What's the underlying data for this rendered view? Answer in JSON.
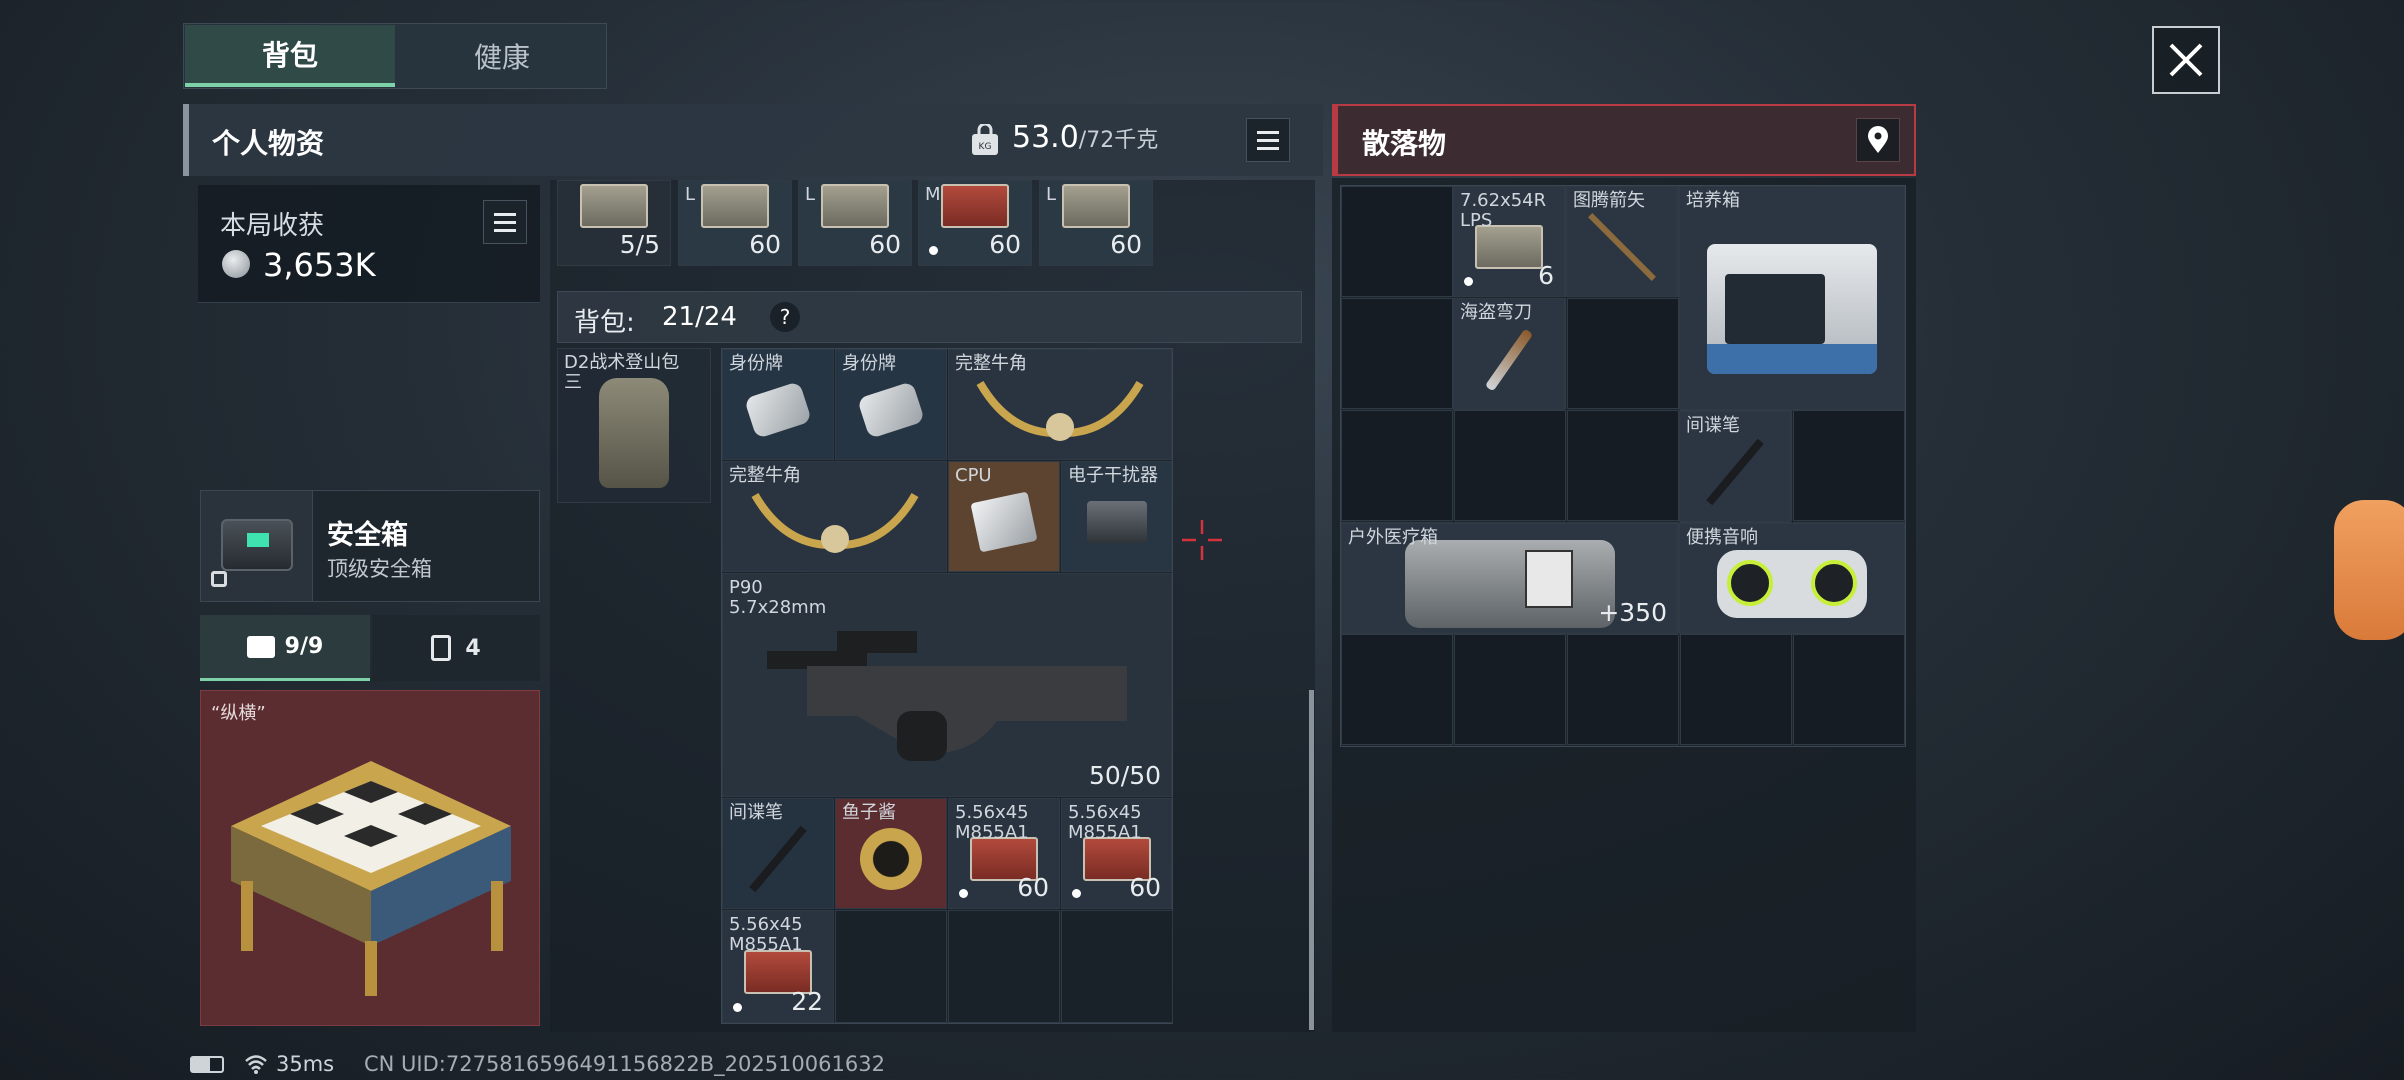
{
  "tabs": {
    "backpack": "背包",
    "health": "健康"
  },
  "personal": {
    "title": "个人物资",
    "weight": "53.0",
    "weight_max": "/72千克"
  },
  "earnings": {
    "label": "本局收获",
    "value": "3,653K"
  },
  "safebox": {
    "name": "安全箱",
    "desc": "顶级安全箱"
  },
  "subtabs": {
    "case_count": "9/9",
    "container_count": "4"
  },
  "featured_item": {
    "name": "“纵横”"
  },
  "top_row": [
    {
      "name": "",
      "count": "5/5",
      "dot": false
    },
    {
      "name": "L",
      "count": "60",
      "dot": false
    },
    {
      "name": "L",
      "count": "60",
      "dot": false
    },
    {
      "name": "M",
      "count": "60",
      "dot": true
    },
    {
      "name": "L",
      "count": "60",
      "dot": false
    }
  ],
  "backpack": {
    "label": "背包:",
    "capacity": "21/24",
    "help": "?",
    "bag_name": "D2战术登山包\n三"
  },
  "items": {
    "dogtag1": "身份牌",
    "dogtag2": "身份牌",
    "horn1": "完整牛角",
    "horn2": "完整牛角",
    "cpu": "CPU",
    "jammer": "电子干扰器",
    "p90_name": "P90\n5.7x28mm",
    "p90_count": "50/50",
    "spy_pen": "间谍笔",
    "caviar": "鱼子酱",
    "ammo1_name": "5.56x45\nM855A1",
    "ammo1_count": "60",
    "ammo2_name": "5.56x45\nM855A1",
    "ammo2_count": "60",
    "ammo3_name": "5.56x45\nM855A1",
    "ammo3_count": "22"
  },
  "loot": {
    "title": "散落物",
    "ammo_name": "7.62x54R\nLPS",
    "ammo_count": "6",
    "arrow": "图腾箭矢",
    "incubator": "培养箱",
    "cutlass": "海盗弯刀",
    "spy_pen": "间谍笔",
    "medkit": "户外医疗箱",
    "medkit_value": "350",
    "speaker": "便携音响"
  },
  "status": {
    "ping": "35ms",
    "uid": "CN UID:7275816596491156822B_202510061632"
  },
  "colors": {
    "accent_green": "#7fd1a8",
    "loot_red": "#b83a43",
    "rare_red": "#5b2c30"
  }
}
